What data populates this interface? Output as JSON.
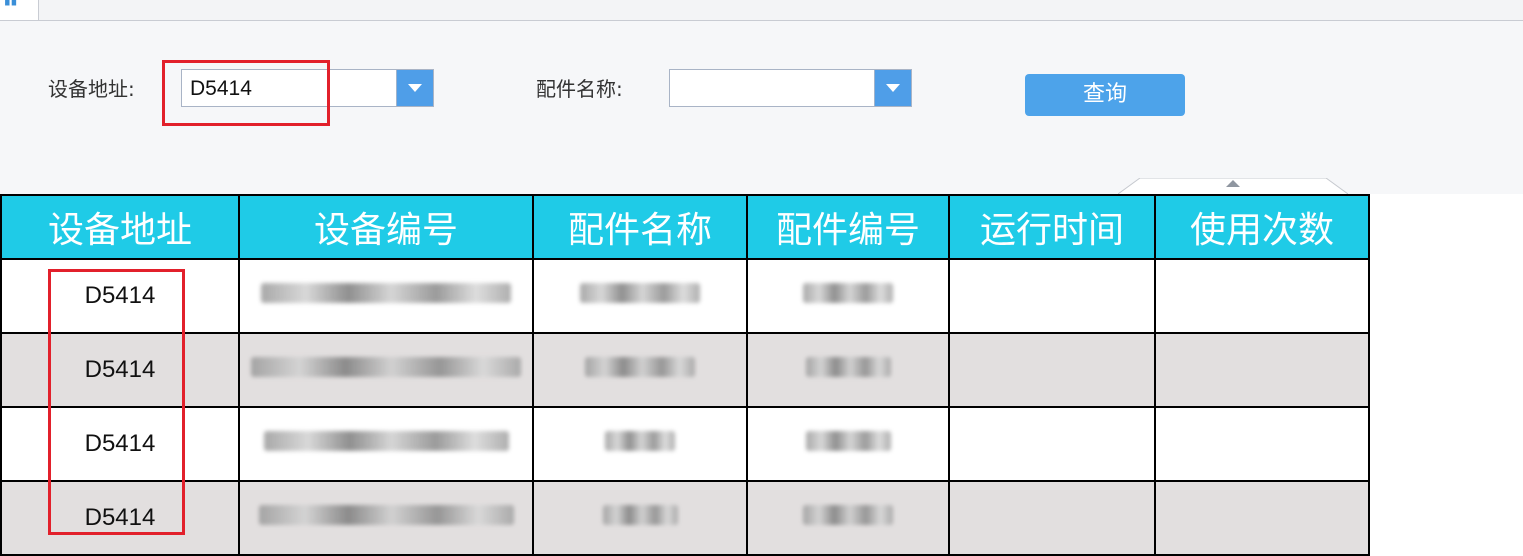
{
  "filter": {
    "address_label": "设备地址:",
    "address_value": "D5414",
    "part_name_label": "配件名称:",
    "part_name_value": "",
    "query_button": "查询"
  },
  "table": {
    "headers": [
      "设备地址",
      "设备编号",
      "配件名称",
      "配件编号",
      "运行时间",
      "使用次数"
    ],
    "rows": [
      {
        "address": "D5414",
        "device_no": "",
        "part_name": "",
        "part_no": "",
        "run_time": "",
        "use_count": ""
      },
      {
        "address": "D5414",
        "device_no": "",
        "part_name": "",
        "part_no": "",
        "run_time": "",
        "use_count": ""
      },
      {
        "address": "D5414",
        "device_no": "",
        "part_name": "",
        "part_no": "",
        "run_time": "",
        "use_count": ""
      },
      {
        "address": "D5414",
        "device_no": "",
        "part_name": "",
        "part_no": "",
        "run_time": "",
        "use_count": ""
      }
    ]
  },
  "colors": {
    "header_bg": "#1fcbe7",
    "button_bg": "#4da3ea",
    "highlight": "#e2202b",
    "alt_row": "#e2dfdf"
  }
}
